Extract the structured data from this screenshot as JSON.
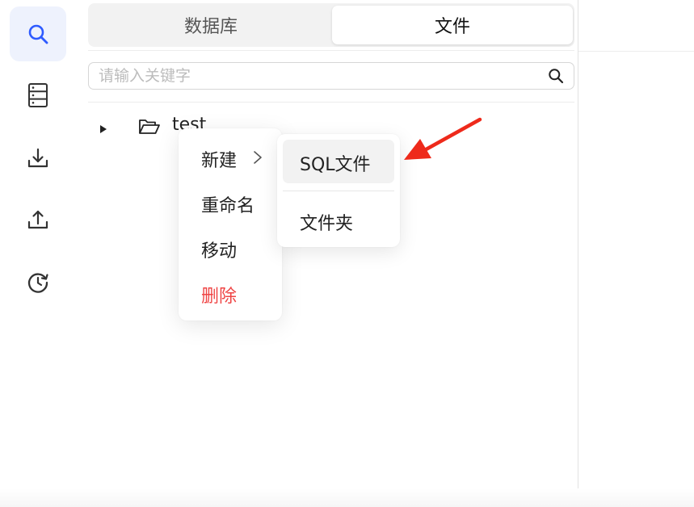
{
  "rail": {
    "items": [
      {
        "icon": "search-icon",
        "active": true
      },
      {
        "icon": "database-icon",
        "active": false
      },
      {
        "icon": "download-icon",
        "active": false
      },
      {
        "icon": "upload-icon",
        "active": false
      },
      {
        "icon": "history-icon",
        "active": false
      }
    ]
  },
  "tabs": {
    "database": "数据库",
    "files": "文件",
    "active": "files"
  },
  "search": {
    "placeholder": "请输入关键字",
    "value": ""
  },
  "tree": {
    "items": [
      {
        "label": "test",
        "type": "folder",
        "expanded": false
      }
    ]
  },
  "context_menu": {
    "new": "新建",
    "rename": "重命名",
    "move": "移动",
    "delete": "删除"
  },
  "submenu": {
    "sql_file": "SQL文件",
    "folder": "文件夹"
  },
  "colors": {
    "accent": "#2e5bff",
    "danger": "#ef4444",
    "annotation": "#ee2a1b"
  }
}
